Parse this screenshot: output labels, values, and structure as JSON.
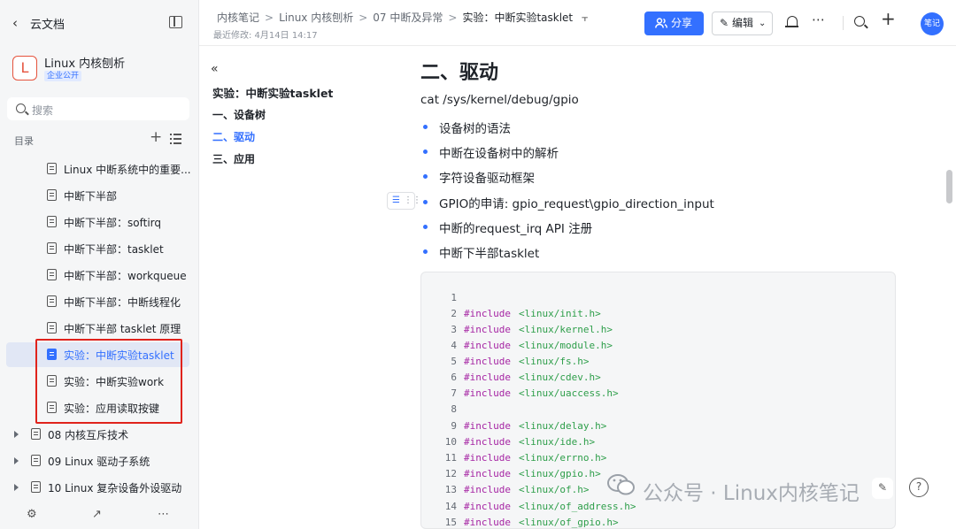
{
  "sidebar": {
    "back_label": "云文档",
    "kb_initial": "L",
    "kb_name": "Linux 内核刨析",
    "kb_badge": "企业公开",
    "search_placeholder": "搜索",
    "toc_label": "目录",
    "tree": [
      {
        "label": "Linux 中断系统中的重要..."
      },
      {
        "label": "中断下半部"
      },
      {
        "label": "中断下半部：softirq"
      },
      {
        "label": "中断下半部：tasklet"
      },
      {
        "label": "中断下半部：workqueue"
      },
      {
        "label": "中断下半部：中断线程化"
      },
      {
        "label": "中断下半部 tasklet 原理"
      },
      {
        "label": "实验：中断实验tasklet"
      },
      {
        "label": "实验：中断实验work"
      },
      {
        "label": "实验：应用读取按键"
      },
      {
        "label": "08 内核互斥技术"
      },
      {
        "label": "09 Linux 驱动子系统"
      },
      {
        "label": "10 Linux 复杂设备外设驱动"
      }
    ]
  },
  "header": {
    "breadcrumbs": [
      "内核笔记",
      "Linux 内核刨析",
      "07 中断及异常",
      "实验：中断实验tasklet"
    ],
    "modified": "最近修改: 4月14日 14:17",
    "share_label": "分享",
    "edit_label": "编辑",
    "avatar_label": "笔记"
  },
  "outline": {
    "title": "实验：中断实验tasklet",
    "items": [
      "一、设备树",
      "二、驱动",
      "三、应用"
    ],
    "current": "二、驱动"
  },
  "content": {
    "heading": "二、驱动",
    "paragraph": "cat /sys/kernel/debug/gpio",
    "bullets": [
      "设备树的语法",
      "中断在设备树中的解析",
      "字符设备驱动框架",
      "GPIO的申请: gpio_request\\gpio_direction_input",
      "中断的request_irq API 注册",
      "中断下半部tasklet"
    ],
    "code": [
      {
        "n": "1",
        "kw": "",
        "inc": ""
      },
      {
        "n": "2",
        "kw": "#include",
        "inc": "<linux/init.h>"
      },
      {
        "n": "3",
        "kw": "#include",
        "inc": "<linux/kernel.h>"
      },
      {
        "n": "4",
        "kw": "#include",
        "inc": "<linux/module.h>"
      },
      {
        "n": "5",
        "kw": "#include",
        "inc": "<linux/fs.h>"
      },
      {
        "n": "6",
        "kw": "#include",
        "inc": "<linux/cdev.h>"
      },
      {
        "n": "7",
        "kw": "#include",
        "inc": "<linux/uaccess.h>"
      },
      {
        "n": "8",
        "kw": "",
        "inc": ""
      },
      {
        "n": "9",
        "kw": "#include",
        "inc": "<linux/delay.h>"
      },
      {
        "n": "10",
        "kw": "#include",
        "inc": "<linux/ide.h>"
      },
      {
        "n": "11",
        "kw": "#include",
        "inc": "<linux/errno.h>"
      },
      {
        "n": "12",
        "kw": "#include",
        "inc": "<linux/gpio.h>"
      },
      {
        "n": "13",
        "kw": "#include",
        "inc": "<linux/of.h>"
      },
      {
        "n": "14",
        "kw": "#include",
        "inc": "<linux/of_address.h>"
      },
      {
        "n": "15",
        "kw": "#include",
        "inc": "<linux/of_gpio.h>"
      }
    ]
  },
  "watermark": "公众号 · Linux内核笔记",
  "colors": {
    "accent": "#3370ff",
    "highlight_box": "#e0231c"
  }
}
